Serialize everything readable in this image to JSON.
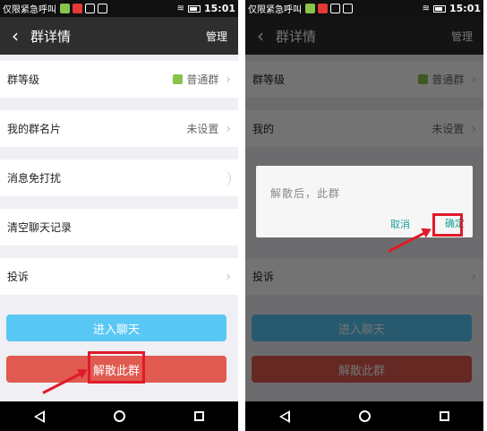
{
  "status_bar": {
    "carrier": "仅限紧急呼叫",
    "time": "15:01"
  },
  "header": {
    "back_icon": "chevron-left-icon",
    "title": "群详情",
    "manage_label": "管理"
  },
  "rows": {
    "group_level_label": "群等级",
    "group_level_value": "普通群",
    "group_card_label": "我的群名片",
    "group_card_value": "未设置",
    "mute_label": "消息免打扰",
    "clear_history_label": "清空聊天记录",
    "report_label": "投诉"
  },
  "buttons": {
    "enter_chat": "进入聊天",
    "dissolve": "解散此群"
  },
  "dialog": {
    "message": "解散后，此群",
    "cancel": "取消",
    "confirm": "确定"
  },
  "right_rows": {
    "group_card_label": "我的"
  },
  "colors": {
    "header_bg": "#2e2e2e",
    "chat_button": "#5ac8f5",
    "dissolve_button": "#e05a4f",
    "dialog_accent": "#1aa19a",
    "highlight": "#e01a2a"
  }
}
